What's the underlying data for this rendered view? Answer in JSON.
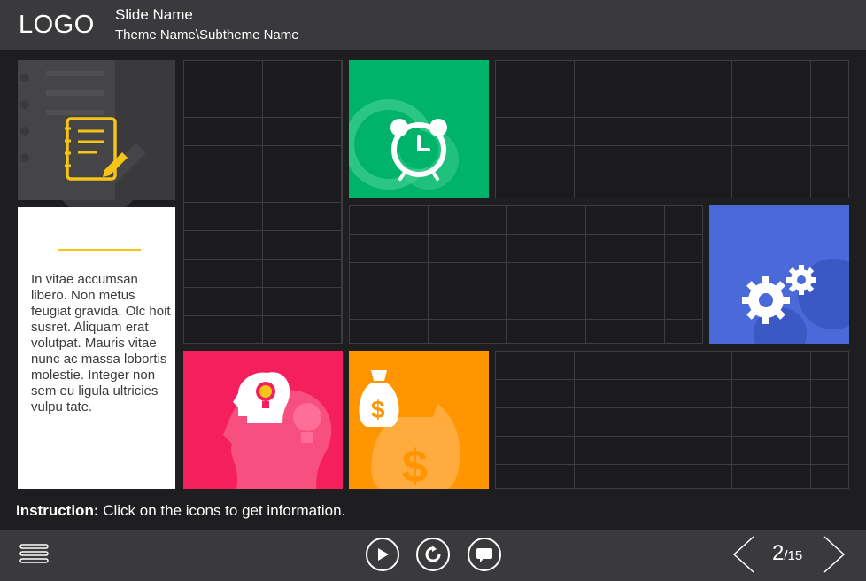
{
  "header": {
    "logo": "LOGO",
    "slide_name": "Slide Name",
    "theme_name": "Theme Name\\Subtheme Name"
  },
  "card": {
    "text": "In vitae accumsan libero. Non metus feugiat gravida. Olc hoit susret. Aliquam erat volutpat. Mauris vitae nunc ac massa lobortis molestie. Integer non sem eu ligula ultricies vulpu tate."
  },
  "instruction": {
    "label": "Instruction:",
    "text": " Click on the icons to get information."
  },
  "tiles": {
    "notes_icon": "notepad-icon",
    "alarm_icon": "alarm-clock-icon",
    "gears_icon": "gears-icon",
    "idea_icon": "head-idea-icon",
    "money_icon": "money-bag-icon"
  },
  "colors": {
    "green": "#00b36b",
    "blue": "#4a6ad9",
    "pink": "#f51f5e",
    "orange": "#ff9500",
    "yellow": "#f5c416",
    "dark": "#3a3a3d"
  },
  "footer": {
    "page_current": "2",
    "page_total": "/15"
  }
}
